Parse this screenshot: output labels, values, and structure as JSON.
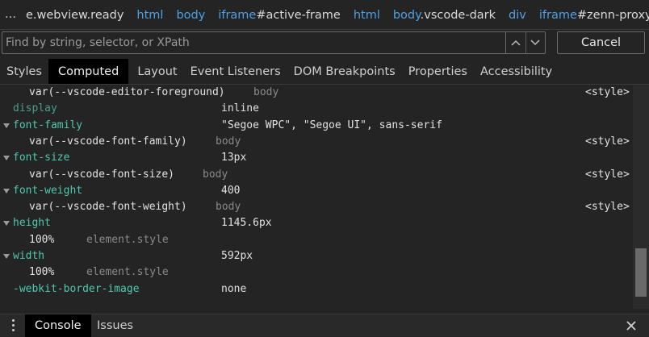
{
  "breadcrumb": {
    "more_glyph": "…",
    "items": [
      {
        "tag": "",
        "sel": "e.webview.ready"
      },
      {
        "tag": "html",
        "sel": ""
      },
      {
        "tag": "body",
        "sel": ""
      },
      {
        "tag": "iframe",
        "sel": "#active-frame"
      },
      {
        "tag": "html",
        "sel": ""
      },
      {
        "tag": "body",
        "sel": ".vscode-dark"
      },
      {
        "tag": "div",
        "sel": ""
      },
      {
        "tag": "iframe",
        "sel": "#zenn-proxy"
      }
    ]
  },
  "search": {
    "placeholder": "Find by string, selector, or XPath",
    "value": "",
    "prev_icon": "chevron-up-icon",
    "next_icon": "chevron-down-icon",
    "cancel_label": "Cancel"
  },
  "tabs": [
    {
      "label": "Styles",
      "active": false
    },
    {
      "label": "Computed",
      "active": true
    },
    {
      "label": "Layout",
      "active": false
    },
    {
      "label": "Event Listeners",
      "active": false
    },
    {
      "label": "DOM Breakpoints",
      "active": false
    },
    {
      "label": "Properties",
      "active": false
    },
    {
      "label": "Accessibility",
      "active": false
    }
  ],
  "computed": {
    "top_trace": {
      "value": "var(--vscode-editor-foreground)",
      "source": "body",
      "file": "<style>"
    },
    "properties": [
      {
        "name": "display",
        "value": "inline",
        "expanded": false,
        "inherited": true,
        "traces": []
      },
      {
        "name": "font-family",
        "value": "\"Segoe WPC\", \"Segoe UI\", sans-serif",
        "expanded": true,
        "inherited": false,
        "traces": [
          {
            "value": "var(--vscode-font-family)",
            "source": "body",
            "file": "<style>"
          }
        ]
      },
      {
        "name": "font-size",
        "value": "13px",
        "expanded": true,
        "inherited": false,
        "traces": [
          {
            "value": "var(--vscode-font-size)",
            "source": "body",
            "file": "<style>"
          }
        ]
      },
      {
        "name": "font-weight",
        "value": "400",
        "expanded": true,
        "inherited": false,
        "traces": [
          {
            "value": "var(--vscode-font-weight)",
            "source": "body",
            "file": "<style>"
          }
        ]
      },
      {
        "name": "height",
        "value": "1145.6px",
        "expanded": true,
        "inherited": false,
        "traces": [
          {
            "value": "100%",
            "source": "element.style",
            "file": ""
          }
        ]
      },
      {
        "name": "width",
        "value": "592px",
        "expanded": true,
        "inherited": false,
        "traces": [
          {
            "value": "100%",
            "source": "element.style",
            "file": ""
          }
        ]
      },
      {
        "name": "-webkit-border-image",
        "value": "none",
        "expanded": false,
        "inherited": false,
        "traces": []
      }
    ]
  },
  "drawer": {
    "menu_icon": "more-vertical-icon",
    "tabs": [
      {
        "label": "Console",
        "active": true
      },
      {
        "label": "Issues",
        "active": false
      }
    ],
    "close_icon": "close-icon"
  },
  "colors": {
    "background": "#242424",
    "property_name": "#4ec9b0",
    "link": "#4ea1e6",
    "muted": "#8a8a8a"
  }
}
